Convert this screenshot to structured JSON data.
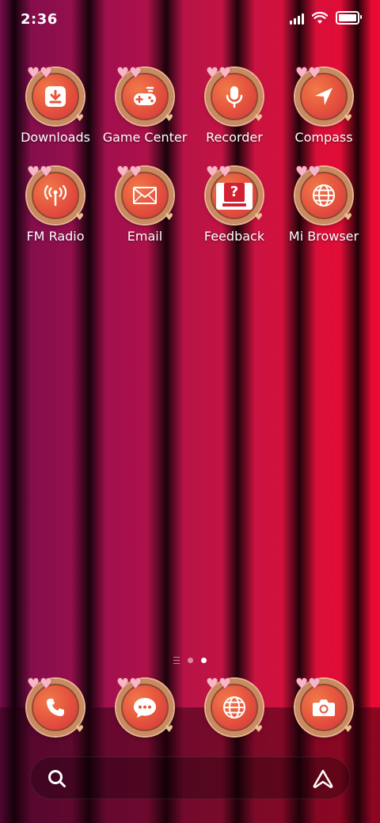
{
  "status_bar": {
    "time": "2:36",
    "signal_bars": 4,
    "wifi": true,
    "battery_percent": 100
  },
  "home_apps": [
    {
      "label": "Downloads",
      "icon": "download-icon"
    },
    {
      "label": "Game Center",
      "icon": "gamepad-icon"
    },
    {
      "label": "Recorder",
      "icon": "microphone-icon"
    },
    {
      "label": "Compass",
      "icon": "compass-arrow-icon"
    },
    {
      "label": "FM Radio",
      "icon": "radio-antenna-icon"
    },
    {
      "label": "Email",
      "icon": "envelope-icon"
    },
    {
      "label": "Feedback",
      "icon": "question-box-icon"
    },
    {
      "label": "Mi Browser",
      "icon": "globe-icon"
    }
  ],
  "feedback_badge": "?",
  "pager": {
    "pages": 2,
    "active": 2
  },
  "dock_apps": [
    {
      "name": "phone",
      "icon": "phone-icon"
    },
    {
      "name": "messages",
      "icon": "chat-bubble-icon"
    },
    {
      "name": "browser",
      "icon": "globe-icon"
    },
    {
      "name": "camera",
      "icon": "camera-icon"
    }
  ],
  "search_bar": {
    "left_icon": "search-icon",
    "right_icon": "assistant-icon"
  },
  "colors": {
    "wallpaper_left": "#7a0d4c",
    "wallpaper_right": "#ea0a32",
    "icon_fill": "#e6563e",
    "icon_frame": "#c98a62"
  }
}
